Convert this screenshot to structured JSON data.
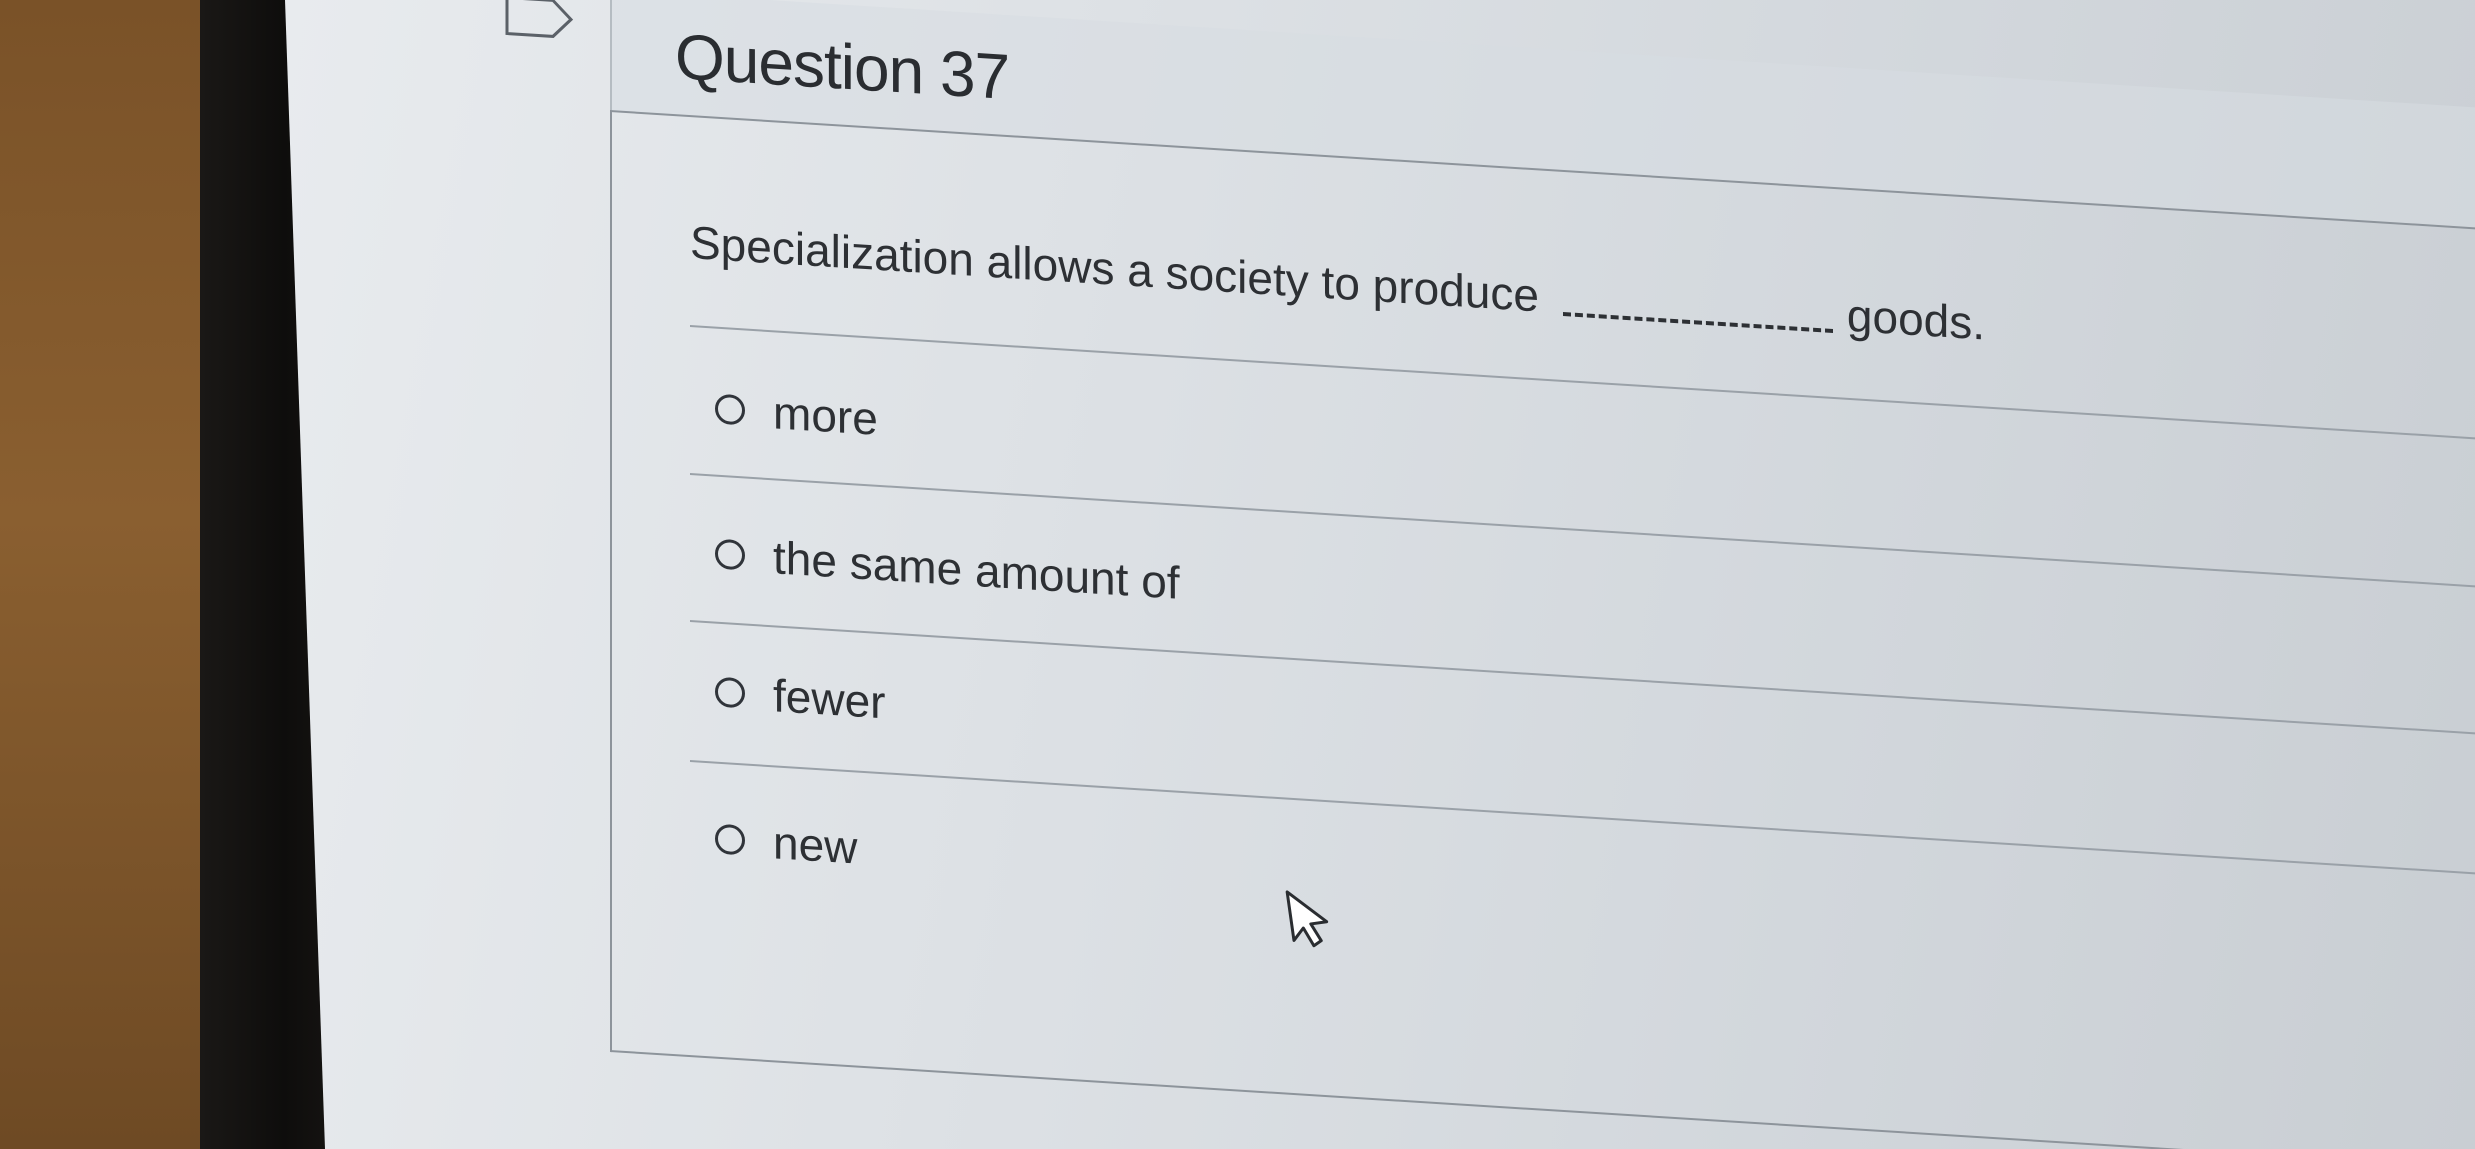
{
  "question": {
    "title": "Question 37",
    "text_before": "Specialization allows a society to produce",
    "text_after": "goods."
  },
  "options": [
    {
      "label": "more",
      "selected": false
    },
    {
      "label": "the same amount of",
      "selected": false
    },
    {
      "label": "fewer",
      "selected": false
    },
    {
      "label": "new",
      "selected": false
    }
  ],
  "icons": {
    "flag": "flag-icon",
    "cursor": "mouse-pointer-icon",
    "radio": "radio-unselected-icon"
  },
  "colors": {
    "screen_bg": "#dde1e5",
    "text": "#2d3034",
    "border": "#8d949b"
  }
}
